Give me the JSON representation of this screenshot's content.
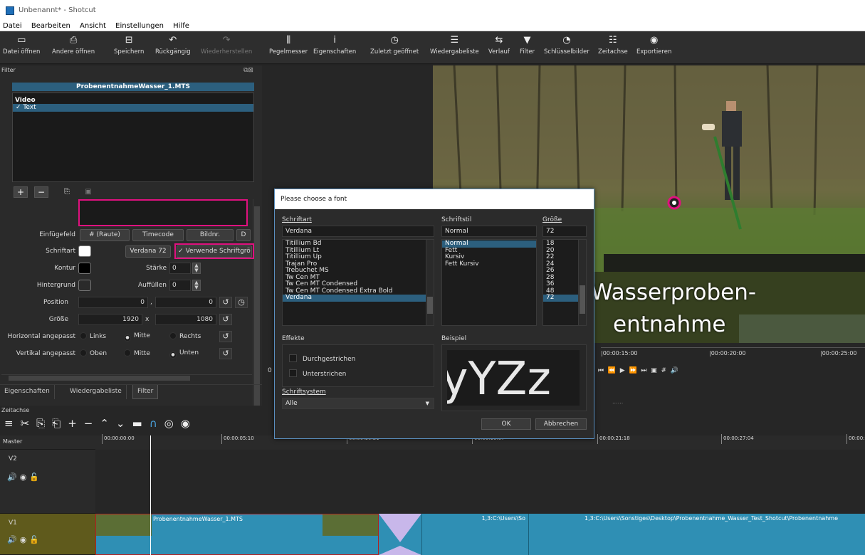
{
  "window": {
    "title": "Unbenannt* - Shotcut"
  },
  "menu": [
    "Datei",
    "Bearbeiten",
    "Ansicht",
    "Einstellungen",
    "Hilfe"
  ],
  "toolbar": [
    {
      "label": "Datei öffnen",
      "icon": "folder-icon"
    },
    {
      "label": "Andere öffnen",
      "icon": "open-other-icon"
    },
    {
      "label": "Speichern",
      "icon": "save-icon"
    },
    {
      "label": "Rückgängig",
      "icon": "undo-icon"
    },
    {
      "label": "Wiederherstellen",
      "icon": "redo-icon",
      "disabled": true
    },
    {
      "label": "Pegelmesser",
      "icon": "meter-icon"
    },
    {
      "label": "Eigenschaften",
      "icon": "info-icon"
    },
    {
      "label": "Zuletzt geöffnet",
      "icon": "clock-icon"
    },
    {
      "label": "Wiedergabeliste",
      "icon": "list-icon"
    },
    {
      "label": "Verlauf",
      "icon": "history-icon"
    },
    {
      "label": "Filter",
      "icon": "filter-icon"
    },
    {
      "label": "Schlüsselbilder",
      "icon": "keyframe-icon"
    },
    {
      "label": "Zeitachse",
      "icon": "timeline-icon"
    },
    {
      "label": "Exportieren",
      "icon": "export-icon"
    }
  ],
  "filter_panel": {
    "title": "Filter",
    "clip_name": "ProbenentnahmeWasser_1.MTS",
    "group_label": "Video",
    "filter_item": "✓ Text",
    "text_value": "",
    "einfuegefeld_label": "Einfügefeld",
    "btn_raute": "# (Raute)",
    "btn_timecode": "Timecode",
    "btn_bildnr": "Bildnr.",
    "btn_more": "D",
    "schriftart_label": "Schriftart",
    "schriftart_color": "#ffffff",
    "font_btn": "Verdana 72",
    "use_font_size": "✓ Verwende Schriftgrö",
    "kontur_label": "Kontur",
    "kontur_color": "#000000",
    "staerke_label": "Stärke",
    "staerke_value": "0",
    "hintergrund_label": "Hintergrund",
    "auffuellen_label": "Auffüllen",
    "auffuellen_value": "0",
    "position_label": "Position",
    "position_x": "0",
    "position_sep": ",",
    "position_y": "0",
    "groesse_label": "Größe",
    "groesse_w": "1920",
    "groesse_sep": "x",
    "groesse_h": "1080",
    "h_label": "Horizontal angepasst",
    "h_options": [
      "Links",
      "Mitte",
      "Rechts"
    ],
    "v_label": "Vertikal angepasst",
    "v_options": [
      "Oben",
      "Mitte",
      "Unten"
    ],
    "tabs": [
      "Eigenschaften",
      "Wiedergabeliste",
      "Filter"
    ],
    "mid_zero": "0"
  },
  "font_dialog": {
    "title": "Please choose a font",
    "family_label": "Schriftart",
    "family_value": "Verdana",
    "families": [
      "Titillium Bd",
      "Titillium Lt",
      "Titillium Up",
      "Trajan Pro",
      "Trebuchet MS",
      "Tw Cen MT",
      "Tw Cen MT Condensed",
      "Tw Cen MT Condensed Extra Bold",
      "Verdana"
    ],
    "style_label": "Schriftstil",
    "style_value": "Normal",
    "styles": [
      "Normal",
      "Fett",
      "Kursiv",
      "Fett Kursiv"
    ],
    "size_label": "Größe",
    "size_value": "72",
    "sizes": [
      "18",
      "20",
      "22",
      "24",
      "26",
      "28",
      "36",
      "48",
      "72"
    ],
    "effects_label": "Effekte",
    "strike_label": "Durchgestrichen",
    "underline_label": "Unterstrichen",
    "sample_label": "Beispiel",
    "sample_text": "/yYZz",
    "writing_system_label": "Schriftsystem",
    "writing_system_value": "Alle",
    "ok": "OK",
    "cancel": "Abbrechen"
  },
  "video": {
    "overlay_line1": "Wasserproben-",
    "overlay_line2": "entnahme"
  },
  "player": {
    "times": [
      "|00:00:15:00",
      "|00:00:20:00",
      "|00:00:25:00"
    ],
    "dots": "......"
  },
  "timeline": {
    "title": "Zeitachse",
    "master": "Master",
    "ticks": [
      "00:00:00:00",
      "00:00:05:10",
      "00:00:10:21",
      "00:00:16:07",
      "00:00:21:18",
      "00:00:27:04",
      "00:00:"
    ],
    "v2": "V2",
    "v1": "V1",
    "clip1": "ProbenentnahmeWasser_1.MTS",
    "clip2": "1,3:C:\\Users\\So",
    "clip3": "1,3:C:\\Users\\Sonstiges\\Desktop\\Probenentnahme_Wasser_Test_Shotcut\\Probenentnahme"
  },
  "colors": {
    "accent": "#e0117f",
    "selection": "#2c5f7e",
    "clip": "#2f8fb4"
  }
}
